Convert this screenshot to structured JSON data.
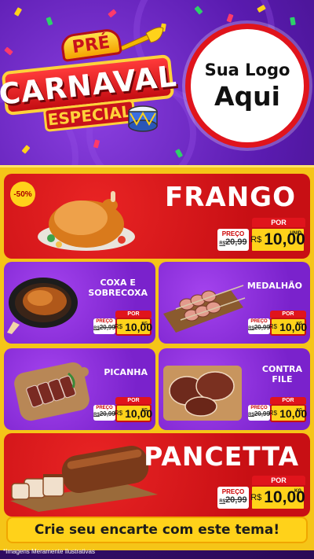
{
  "header": {
    "pre": "PRÉ",
    "carnaval": "CARNAVAL",
    "especial": "ESPECIAL",
    "logo_line1": "Sua Logo",
    "logo_line2": "Aqui"
  },
  "products": {
    "frango": {
      "name": "FRANGO",
      "discount": "-50%",
      "preco_label": "PREÇO",
      "old_price": "20,99",
      "old_prefix": "R$",
      "por_label": "POR",
      "currency": "R$",
      "price": "10,00",
      "unit": "UNID"
    },
    "coxa": {
      "name_line1": "COXA E",
      "name_line2": "SOBRECOXA",
      "preco_label": "PREÇO",
      "old_price": "20,99",
      "old_prefix": "R$",
      "por_label": "POR",
      "currency": "R$",
      "price": "10,00",
      "unit": "KG"
    },
    "medalhao": {
      "name": "MEDALHÃO",
      "preco_label": "PREÇO",
      "old_price": "20,99",
      "old_prefix": "R$",
      "por_label": "POR",
      "currency": "R$",
      "price": "10,00",
      "unit": "KG"
    },
    "picanha": {
      "name": "PICANHA",
      "preco_label": "PREÇO",
      "old_price": "20,99",
      "old_prefix": "R$",
      "por_label": "POR",
      "currency": "R$",
      "price": "10,00",
      "unit": "KG"
    },
    "contra": {
      "name_line1": "CONTRA",
      "name_line2": "FILE",
      "preco_label": "PREÇO",
      "old_price": "20,99",
      "old_prefix": "R$",
      "por_label": "POR",
      "currency": "R$",
      "price": "10,00",
      "unit": "KG"
    },
    "pancetta": {
      "name": "PANCETTA",
      "preco_label": "PREÇO",
      "old_price": "20,99",
      "old_prefix": "R$",
      "por_label": "POR",
      "currency": "R$",
      "price": "10,00",
      "unit": "KG"
    }
  },
  "footer": {
    "cta": "Crie seu encarte com este tema!",
    "disclaimer": "*Imagens Meramente Ilustrativas"
  },
  "colors": {
    "red": "#c80f14",
    "purple": "#7a22cc",
    "yellow": "#f5c518",
    "price_yellow": "#ffd21a"
  },
  "icons": [
    "trumpet-icon",
    "drum-icon",
    "roast-chicken-icon",
    "chicken-leg-pan-icon",
    "skewers-icon",
    "picanha-board-icon",
    "steak-board-icon",
    "pancetta-roast-icon"
  ]
}
